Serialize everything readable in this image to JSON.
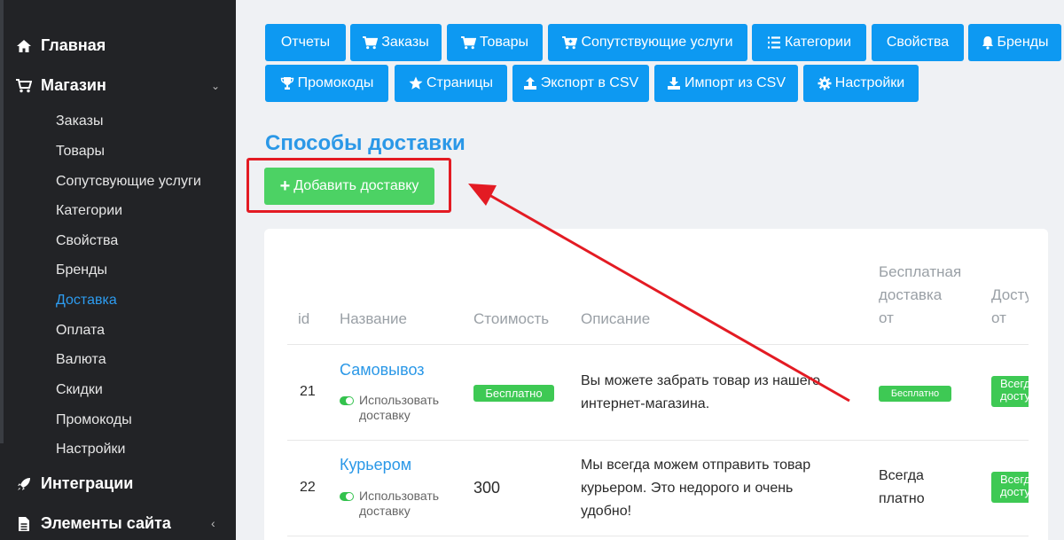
{
  "sidebar": {
    "main": {
      "label": "Главная",
      "icon": "home-icon"
    },
    "shop": {
      "label": "Магазин",
      "icon": "cart-icon"
    },
    "items": [
      {
        "label": "Заказы"
      },
      {
        "label": "Товары"
      },
      {
        "label": "Сопутсвующие услуги"
      },
      {
        "label": "Категории"
      },
      {
        "label": "Свойства"
      },
      {
        "label": "Бренды"
      },
      {
        "label": "Доставка",
        "active": true
      },
      {
        "label": "Оплата"
      },
      {
        "label": "Валюта"
      },
      {
        "label": "Скидки"
      },
      {
        "label": "Промокоды"
      },
      {
        "label": "Настройки"
      }
    ],
    "integrations": {
      "label": "Интеграции",
      "icon": "rocket-icon"
    },
    "site_elements": {
      "label": "Элементы сайта",
      "icon": "file-icon"
    }
  },
  "toolbar": {
    "row1": [
      {
        "label": "Отчеты",
        "icon": ""
      },
      {
        "label": "Заказы",
        "icon": "cart-icon"
      },
      {
        "label": "Товары",
        "icon": "cart-icon"
      },
      {
        "label": "Сопутствующие услуги",
        "icon": "cart-plus-icon"
      },
      {
        "label": "Категории",
        "icon": "list-icon"
      },
      {
        "label": "Свойства",
        "icon": ""
      },
      {
        "label": "Бренды",
        "icon": "bell-icon"
      }
    ],
    "row2": [
      {
        "label": "Промокоды",
        "icon": "trophy-icon"
      },
      {
        "label": "Страницы",
        "icon": "star-icon"
      },
      {
        "label": "Экспорт в CSV",
        "icon": "upload-icon"
      },
      {
        "label": "Импорт из CSV",
        "icon": "download-icon"
      },
      {
        "label": "Настройки",
        "icon": "gear-icon"
      }
    ]
  },
  "page": {
    "title": "Способы доставки",
    "add_button": "Добавить доставку"
  },
  "table": {
    "headers": {
      "id": "id",
      "name": "Название",
      "cost": "Стоимость",
      "description": "Описание",
      "free_line1": "Бесплатная",
      "free_line2": "доставка",
      "free_line3": "от",
      "avail_line1": "Доступно",
      "avail_line2": "от"
    },
    "rows": [
      {
        "id": "21",
        "name": "Самовывоз",
        "toggle_line1": "Использовать",
        "toggle_line2": "доставку",
        "cost": "Бесплатно",
        "description_line1": "Вы можете забрать товар из нашего",
        "description_line2": "интернет-магазина.",
        "free_from": "Бесплатно",
        "avail_line1": "Всегда",
        "avail_line2": "доступно"
      },
      {
        "id": "22",
        "name": "Курьером",
        "toggle_line1": "Использовать",
        "toggle_line2": "доставку",
        "cost": "300",
        "description_line1": "Мы всегда можем отправить товар",
        "description_line2": "курьером. Это недорого и очень",
        "description_line3": "удобно!",
        "free_line1": "Всегда",
        "free_line2": "платно",
        "avail_line1": "Всегда",
        "avail_line2": "доступно"
      }
    ]
  },
  "colors": {
    "sidebar_bg": "#222326",
    "accent_blue": "#0d99f2",
    "active_link": "#2d9cf0",
    "success_green": "#4cd264",
    "highlight_red": "#e31b23"
  }
}
